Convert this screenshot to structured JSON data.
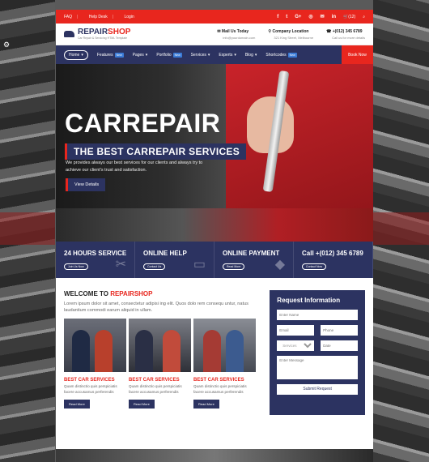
{
  "topbar": {
    "links": [
      "FAQ",
      "Help Desk",
      "Login"
    ],
    "social": [
      "f",
      "t",
      "G+",
      "◎",
      "✉",
      "in"
    ],
    "cart": "(12)"
  },
  "header": {
    "logo_repair": "REPAIR",
    "logo_shop": "SHOP",
    "logo_tag": "Car Repair & Servicing HTML Template",
    "mail_title": "Mail Us Today",
    "mail_sub": "info@yourdomain.com",
    "loc_title": "Company Location",
    "loc_sub": "321 King Street, Melbourne",
    "phone_title": "+(012) 345 6789",
    "phone_sub": "Call us for more details"
  },
  "nav": {
    "items": [
      "Home",
      "Features",
      "Pages",
      "Portfolio",
      "Services",
      "Experts",
      "Blog",
      "Shortcodes"
    ],
    "new_badge": "New",
    "book": "Book Now"
  },
  "hero": {
    "title": "CARREPAIR",
    "subtitle": "THE BEST CARREPAIR SERVICES",
    "text": "We provides always our best services for our clients and always try to achieve our client's trust and satisfaction.",
    "button": "View Details"
  },
  "features": [
    {
      "title": "24 HOURS SERVICE",
      "button": "Join Us Now",
      "icon": "✂"
    },
    {
      "title": "ONLINE HELP",
      "button": "Contact Us",
      "icon": "▭"
    },
    {
      "title": "ONLINE PAYMENT",
      "button": "Read More",
      "icon": "◆"
    },
    {
      "title": "Call +(012) 345 6789",
      "button": "Contact Now",
      "icon": ""
    }
  ],
  "welcome": {
    "title_pre": "WELCOME TO ",
    "title_brand": "REPAIRSHOP",
    "intro": "Lorem ipsum dolor sit amet, consectetur adipisi ing elit. Quos dolo rem consequ untur, natus laudantium commodi earum aliquid in ullam."
  },
  "cards": [
    {
      "t1": "BEST CAR ",
      "t2": "SERVICES",
      "desc": "Quam distinctio quis perspiciatis facere accusamus perferendis",
      "btn": "Read More",
      "colors": [
        "#1f2a44",
        "#b8402c"
      ]
    },
    {
      "t1": "BEST CAR ",
      "t2": "SERVICES",
      "desc": "Quam distinctio quis perspiciatis facere accusamus perferendis",
      "btn": "Read More",
      "colors": [
        "#2a2f45",
        "#c14b3b"
      ]
    },
    {
      "t1": "BEST CAR ",
      "t2": "SERVICES",
      "desc": "Quam distinctio quis perspiciatis facere accusamus perferendis",
      "btn": "Read More",
      "colors": [
        "#a53b34",
        "#3c5b8f"
      ]
    }
  ],
  "form": {
    "title": "Request Information",
    "name_ph": "Enter Name",
    "email_ph": "Email",
    "phone_ph": "Phone",
    "services": "Services",
    "date_ph": "Date",
    "message_ph": "Enter Message",
    "submit": "Submit Request"
  },
  "colors": {
    "brand_red": "#e8261e",
    "brand_navy": "#2c3361"
  }
}
